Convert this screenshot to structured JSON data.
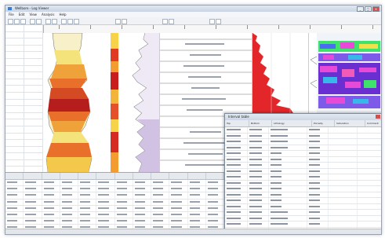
{
  "window": {
    "title": "Wellbore - Log Viewer",
    "minimize": "_",
    "maximize": "□",
    "close": "×"
  },
  "menu": [
    "File",
    "Edit",
    "View",
    "Analysis",
    "Help"
  ],
  "dialog": {
    "title": "Interval table",
    "columns": [
      "Top",
      "Bottom",
      "Lithology",
      "Porosity",
      "Saturation",
      "Comment"
    ]
  },
  "colors": {
    "accent": "#3a7bd5",
    "close": "#d64f4f",
    "curve_red": "#e3262a",
    "lith_yellow": "#f4e27a",
    "lith_orange": "#f0a23a",
    "lith_darkred": "#b61e1e"
  }
}
